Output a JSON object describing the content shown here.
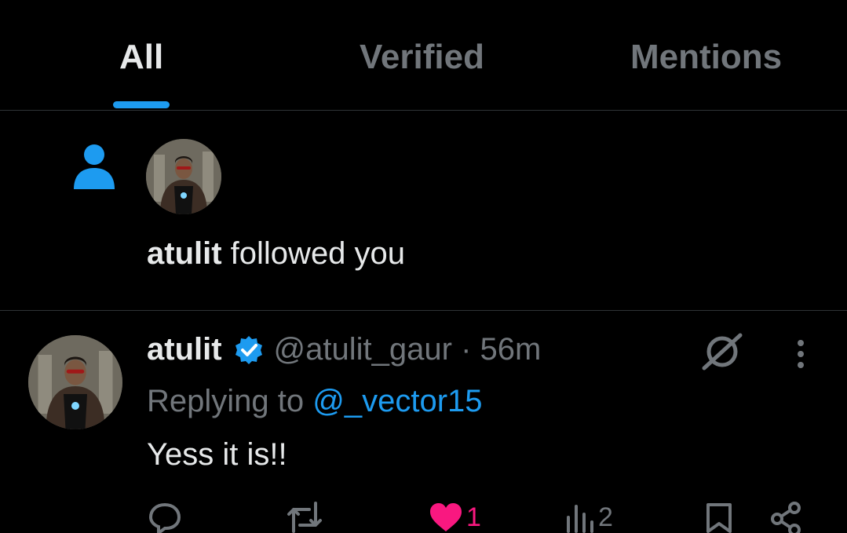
{
  "tabs": [
    {
      "label": "All",
      "active": true
    },
    {
      "label": "Verified",
      "active": false
    },
    {
      "label": "Mentions",
      "active": false
    }
  ],
  "follow_notification": {
    "icon": "person-icon",
    "name": "atulit",
    "text": "followed you"
  },
  "tweet": {
    "name": "atulit",
    "verified": true,
    "handle": "@atulit_gaur · 56m",
    "replying_prefix": "Replying to",
    "replying_to": "@_vector15",
    "text": "Yess it is!!",
    "likes": "1",
    "views": "2"
  },
  "colors": {
    "background": "#000000",
    "text": "#e7e9ea",
    "muted": "#71767b",
    "accent": "#1d9bf0",
    "like": "#f91880",
    "divider": "#2f3336"
  }
}
